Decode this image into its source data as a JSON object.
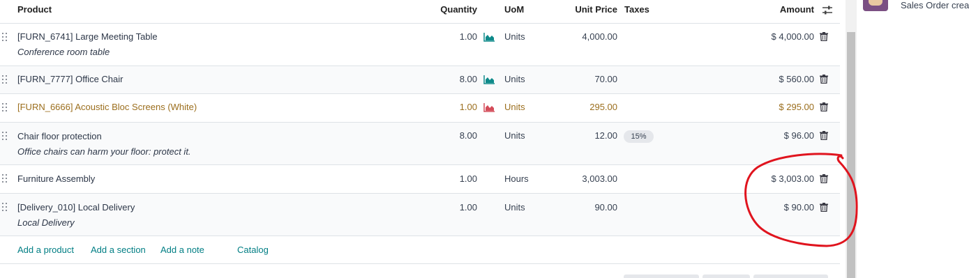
{
  "header": {
    "product": "Product",
    "quantity": "Quantity",
    "uom": "UoM",
    "unit_price": "Unit Price",
    "taxes": "Taxes",
    "amount": "Amount"
  },
  "lines": [
    {
      "name": "[FURN_6741] Large Meeting Table",
      "desc": "Conference room table",
      "qty": "1.00",
      "uom": "Units",
      "price": "4,000.00",
      "tax": "",
      "amount": "$ 4,000.00",
      "forecast": "ok"
    },
    {
      "name": "[FURN_7777] Office Chair",
      "desc": "",
      "qty": "8.00",
      "uom": "Units",
      "price": "70.00",
      "tax": "",
      "amount": "$ 560.00",
      "forecast": "ok"
    },
    {
      "name": "[FURN_6666] Acoustic Bloc Screens (White)",
      "desc": "",
      "qty": "1.00",
      "uom": "Units",
      "price": "295.00",
      "tax": "",
      "amount": "$ 295.00",
      "forecast": "warn"
    },
    {
      "name": "Chair floor protection",
      "desc": "Office chairs can harm your floor: protect it.",
      "qty": "8.00",
      "uom": "Units",
      "price": "12.00",
      "tax": "15%",
      "amount": "$ 96.00",
      "forecast": "none"
    },
    {
      "name": "Furniture Assembly",
      "desc": "",
      "qty": "1.00",
      "uom": "Hours",
      "price": "3,003.00",
      "tax": "",
      "amount": "$ 3,003.00",
      "forecast": "none"
    },
    {
      "name": "[Delivery_010] Local Delivery",
      "desc": "Local Delivery",
      "qty": "1.00",
      "uom": "Units",
      "price": "90.00",
      "tax": "",
      "amount": "$ 90.00",
      "forecast": "none"
    }
  ],
  "add_links": {
    "add_product": "Add a product",
    "add_section": "Add a section",
    "add_note": "Add a note",
    "catalog": "Catalog"
  },
  "chatter": {
    "message": "Sales Order crea"
  },
  "colors": {
    "link": "#017e84",
    "warning_text": "#9b6e1d",
    "forecast_ok": "#0e8a8a",
    "forecast_warn": "#d44c59",
    "annotation": "#e0141e"
  },
  "icons": {
    "settings": "sliders-icon",
    "drag": "drag-handle-icon",
    "forecast": "area-chart-icon",
    "delete": "trash-icon"
  }
}
